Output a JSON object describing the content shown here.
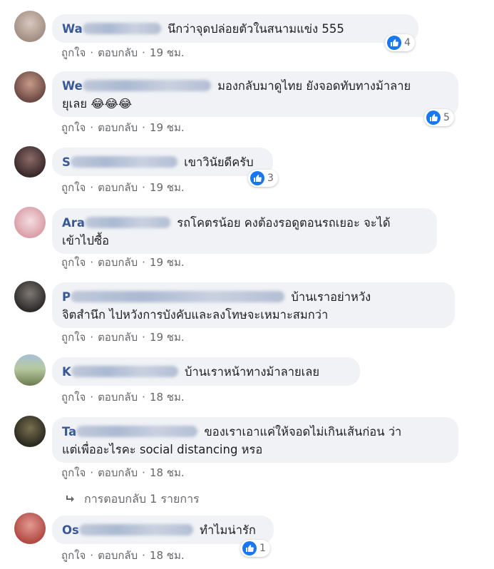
{
  "comments": [
    {
      "author": "Wa",
      "text": "นึกว่าจุดปล่อยตัวในสนามแข่ง 555",
      "like": "ถูกใจ",
      "reply": "ตอบกลับ",
      "time": "19 ชม.",
      "reactions": "4",
      "avatar_color": "#b8a9a0"
    },
    {
      "author": "We",
      "text": "มองกลับมาดูไทย ยังจอดทับทางม้าลาย",
      "text2": "ยุเลย 😂😂😂",
      "like": "ถูกใจ",
      "reply": "ตอบกลับ",
      "time": "19 ชม.",
      "reactions": "5",
      "avatar_color": "#9b6e62"
    },
    {
      "author": "S",
      "text": "เขาวินัยดีครับ",
      "like": "ถูกใจ",
      "reply": "ตอบกลับ",
      "time": "19 ชม.",
      "reactions": "3",
      "avatar_color": "#5a4140"
    },
    {
      "author": "Ara",
      "text": "รถโคตรน้อย คงต้องรอดูตอนรถเยอะ จะได้",
      "text2": "เข้าไปซื้อ",
      "like": "ถูกใจ",
      "reply": "ตอบกลับ",
      "time": "19 ชม.",
      "avatar_color": "#e7c3c7"
    },
    {
      "author": "P",
      "text": "บ้านเราอย่าหวัง",
      "text2": "จิตสำนึก ไปหวังการบังคับและลงโทษจะเหมาะสมกว่า",
      "like": "ถูกใจ",
      "reply": "ตอบกลับ",
      "time": "19 ชม.",
      "avatar_color": "#4e4a46"
    },
    {
      "author": "K",
      "text": "บ้านเราหน้าทางม้าลายเลย",
      "like": "ถูกใจ",
      "reply": "ตอบกลับ",
      "time": "18 ชม.",
      "avatar_color": "#8a9d7b"
    },
    {
      "author": "Ta",
      "text": "ของเราเอาแค่ให้จอดไม่เกินเส้นก่อน ว่า",
      "text2": "แต่เพื่ออะไรคะ social distancing หรอ",
      "like": "ถูกใจ",
      "reply": "ตอบกลับ",
      "time": "18 ชม.",
      "avatar_color": "#3f3c2d"
    },
    {
      "author": "Os",
      "text": "ทำไมน่ารัก",
      "like": "ถูกใจ",
      "reply": "ตอบกลับ",
      "time": "18 ชม.",
      "reactions": "1",
      "avatar_color": "#c25c55"
    }
  ],
  "replies_link": "การตอบกลับ 1 รายการ",
  "icons": {
    "like": "thumbs-up-icon",
    "reply_arrow": "reply-arrow-icon"
  },
  "colors": {
    "like_blue": "#1877f2",
    "author": "#385898",
    "bubble": "#f0f2f5"
  }
}
